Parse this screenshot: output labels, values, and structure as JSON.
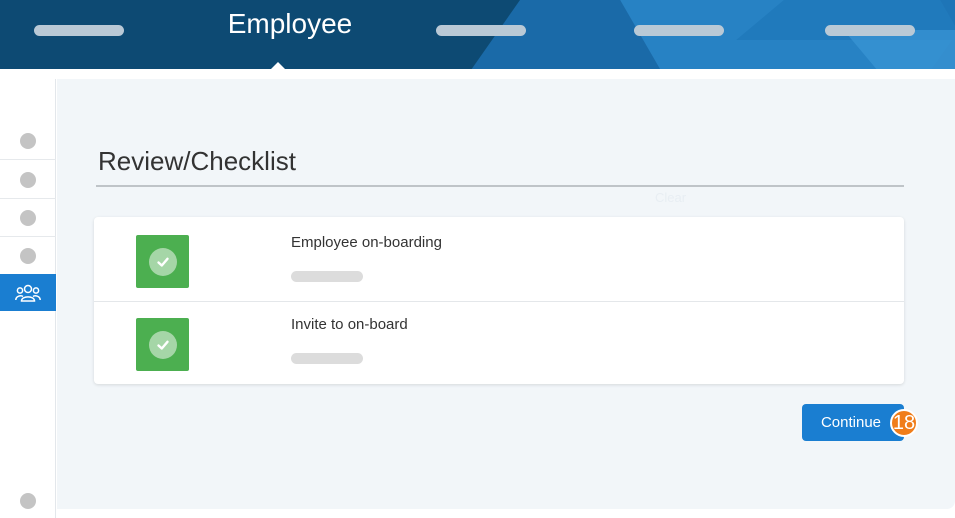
{
  "header": {
    "title": "Employee"
  },
  "sidebar": {
    "items": [
      {
        "icon": "circle-icon",
        "active": false
      },
      {
        "icon": "circle-icon",
        "active": false
      },
      {
        "icon": "circle-icon",
        "active": false
      },
      {
        "icon": "circle-icon",
        "active": false
      },
      {
        "icon": "people-icon",
        "active": true
      }
    ]
  },
  "main": {
    "title": "Review/Checklist",
    "faint_label": "Clear",
    "checklist": [
      {
        "label": "Employee on-boarding",
        "status": "complete"
      },
      {
        "label": "Invite to on-board",
        "status": "complete"
      }
    ]
  },
  "actions": {
    "continue_label": "Continue",
    "step_badge": "18"
  },
  "colors": {
    "header_bg": "#0d4a73",
    "accent": "#1a7ed1",
    "success": "#4caf50",
    "badge": "#f07d1a"
  }
}
